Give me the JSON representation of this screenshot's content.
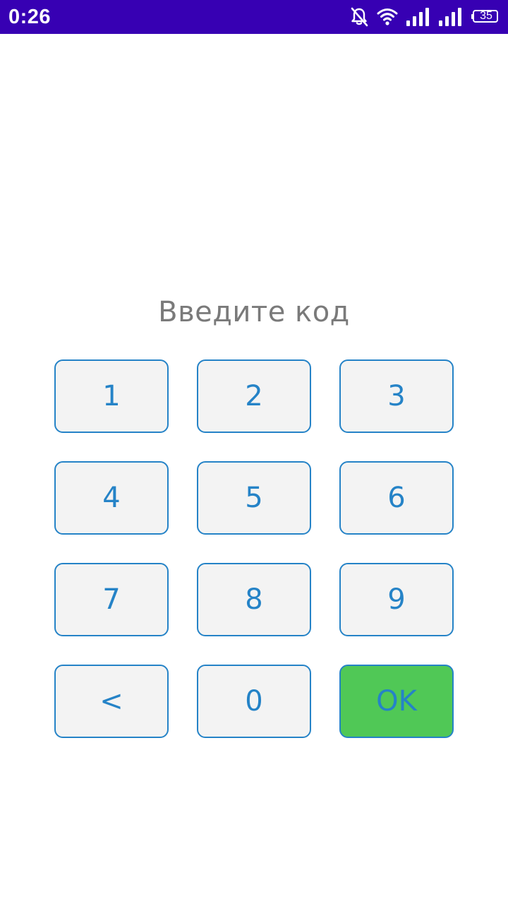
{
  "status_bar": {
    "time": "0:26",
    "battery": "35",
    "background": "#3700b3",
    "icons": [
      "bell-off-icon",
      "wifi-icon",
      "signal-icon",
      "signal-icon",
      "battery-icon"
    ]
  },
  "prompt": "Введите код",
  "keypad": {
    "keys": [
      "1",
      "2",
      "3",
      "4",
      "5",
      "6",
      "7",
      "8",
      "9",
      "<",
      "0",
      "OK"
    ],
    "key_color": "#2583c7",
    "key_background": "#f3f3f3",
    "ok_background": "#50c856"
  }
}
